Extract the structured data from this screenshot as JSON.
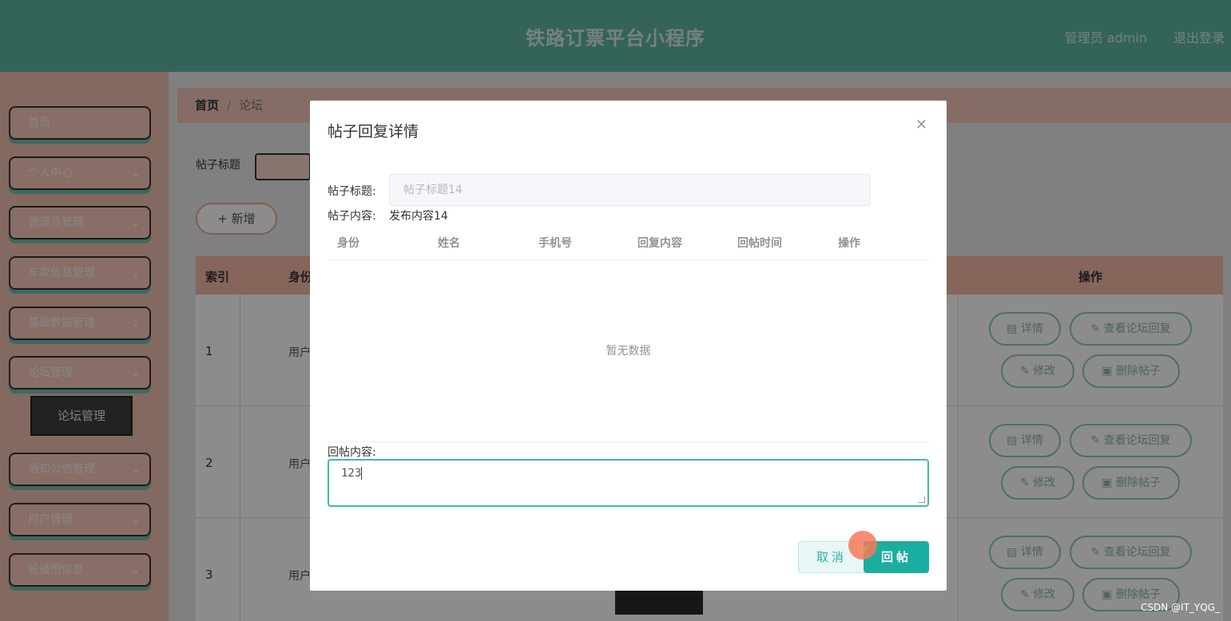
{
  "header": {
    "title": "铁路订票平台小程序",
    "user_label": "管理员 admin",
    "logout_label": "退出登录"
  },
  "sidebar": {
    "items": [
      {
        "label": "首页"
      },
      {
        "label": "个人中心"
      },
      {
        "label": "管理员管理"
      },
      {
        "label": "车次信息管理"
      },
      {
        "label": "基础数据管理"
      },
      {
        "label": "论坛管理"
      },
      {
        "label": "通知公告管理"
      },
      {
        "label": "用户管理"
      },
      {
        "label": "轮播图信息"
      }
    ],
    "expanded_sub": "论坛管理"
  },
  "breadcrumb": {
    "home": "首页",
    "current": "论坛"
  },
  "search": {
    "label": "帖子标题"
  },
  "add_button": "+ 新增",
  "table": {
    "columns": {
      "index": "索引",
      "identity": "身份",
      "actions": "操作"
    },
    "rows": [
      {
        "index": "1",
        "identity": "用户"
      },
      {
        "index": "2",
        "identity": "用户"
      },
      {
        "index": "3",
        "identity": "用户"
      }
    ],
    "row_actions": {
      "detail": "详情",
      "view_replies": "查看论坛回复",
      "edit": "修改",
      "delete": "删除帖子"
    }
  },
  "dialog": {
    "title": "帖子回复详情",
    "post_title_label": "帖子标题:",
    "post_title_value": "帖子标题14",
    "post_content_label": "帖子内容:",
    "post_content_value": "发布内容14",
    "reply_columns": [
      "身份",
      "姓名",
      "手机号",
      "回复内容",
      "回帖时间",
      "操作"
    ],
    "empty_text": "暂无数据",
    "reply_label": "回帖内容:",
    "reply_value": "123",
    "cancel_label": "取消",
    "submit_label": "回帖"
  },
  "watermark": "CSDN @IT_YQG_",
  "colors": {
    "header": "#5fb4a3",
    "sidebar": "#f1bfaf",
    "accent": "#1aaea1",
    "table_header": "#f4b9a7"
  }
}
